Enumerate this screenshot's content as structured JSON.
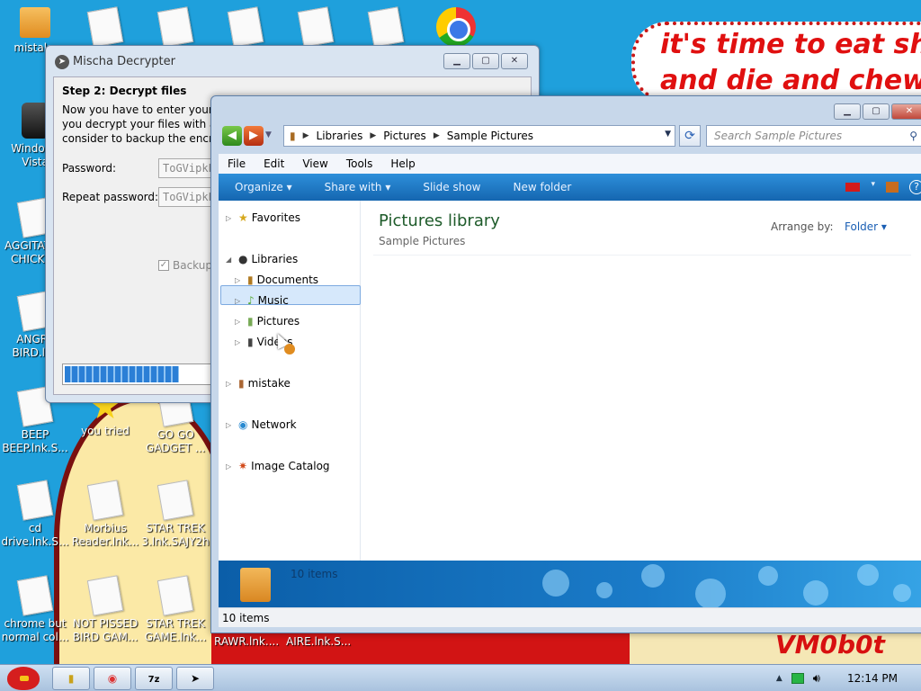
{
  "desktop": {
    "meme_line1": "it's time to eat shit",
    "meme_line2": "and die and chew",
    "tag": "VM0b0t",
    "icons": [
      {
        "label": "mistake",
        "kind": "file"
      },
      {
        "label": "Windows Vista",
        "kind": "bin"
      },
      {
        "label": "AGGITATED CHICKEN",
        "kind": "doc"
      },
      {
        "label": "ANGRY BIRD.lnk",
        "kind": "doc"
      },
      {
        "label": "BEEP BEEP.lnk.S...",
        "kind": "doc"
      },
      {
        "label": "cd drive.lnk.S...",
        "kind": "doc"
      },
      {
        "label": "chrome but normal col...",
        "kind": "doc"
      },
      {
        "label": "you tried",
        "kind": "star"
      },
      {
        "label": "GO GO GADGET ...",
        "kind": "doc"
      },
      {
        "label": "Morbius Reader.lnk...",
        "kind": "doc"
      },
      {
        "label": "STAR TREK 3.lnk.SAJY2h",
        "kind": "doc"
      },
      {
        "label": "NOT PISSED BIRD GAM...",
        "kind": "doc"
      },
      {
        "label": "STAR TREK GAME.lnk...",
        "kind": "doc"
      },
      {
        "label": "RAWR.lnk....",
        "kind": "text"
      },
      {
        "label": "AIRE.lnk.S...",
        "kind": "text"
      }
    ]
  },
  "mischa": {
    "title": "Mischa Decrypter",
    "step": "Step 2: Decrypt files",
    "desc_line1": "Now you have to enter your",
    "desc_line2": "you decrypt your files with a",
    "desc_line3": "consider to backup the encry",
    "password_label": "Password:",
    "password_value": "ToGVipkE",
    "repeat_label": "Repeat password:",
    "repeat_value": "ToGVipkE",
    "backup_label": "Backup",
    "progress": 0.52
  },
  "explorer": {
    "breadcrumb": [
      "Libraries",
      "Pictures",
      "Sample Pictures"
    ],
    "search_placeholder": "Search Sample Pictures",
    "menu": [
      "File",
      "Edit",
      "View",
      "Tools",
      "Help"
    ],
    "commands": [
      "Organize",
      "Share with",
      "Slide show",
      "New folder"
    ],
    "nav": {
      "favorites": "Favorites",
      "libraries": "Libraries",
      "documents": "Documents",
      "music": "Music",
      "pictures": "Pictures",
      "videos": "Videos",
      "mistake": "mistake",
      "network": "Network",
      "image_catalog": "Image Catalog"
    },
    "library_title": "Pictures library",
    "library_sub": "Sample Pictures",
    "arrange_label": "Arrange by:",
    "arrange_value": "Folder",
    "details_count": "10 items",
    "status": "10 items"
  },
  "taskbar": {
    "clock": "12:14 PM"
  }
}
